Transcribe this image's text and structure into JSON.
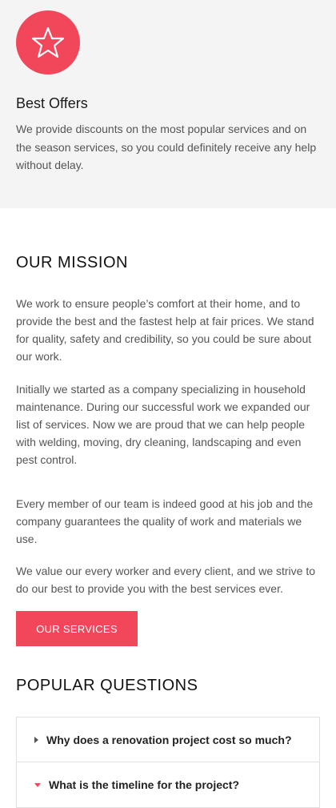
{
  "offer": {
    "icon": "star-outline-icon",
    "title": "Best Offers",
    "text": "We provide discounts on the most popular services and on the season services, so you could definitely receive any help without delay."
  },
  "mission": {
    "title": "OUR MISSION",
    "paragraphs": [
      "We work to ensure people’s comfort at their home, and to provide the best and the fastest help at fair prices. We stand for quality, safety and credibility, so you could be sure about our work.",
      "Initially we started as a company specializing in household maintenance. During our successful work we expanded our list of services. Now we are proud that we can help people with welding, moving, dry cleaning, landscaping and even pest control.",
      "Every member of our team is indeed good at his job and the company guarantees the quality of work and materials we use.",
      "We value our every worker and every client, and we strive to do our best to provide you with the best services ever."
    ],
    "button_label": "OUR SERVICES"
  },
  "questions": {
    "title": "POPULAR QUESTIONS",
    "items": [
      {
        "label": "Why does a renovation project cost so much?",
        "expanded": false
      },
      {
        "label": "What is the timeline for the project?",
        "expanded": true
      }
    ]
  },
  "colors": {
    "accent": "#f2475a",
    "offer_bg": "#f4f4f4"
  }
}
